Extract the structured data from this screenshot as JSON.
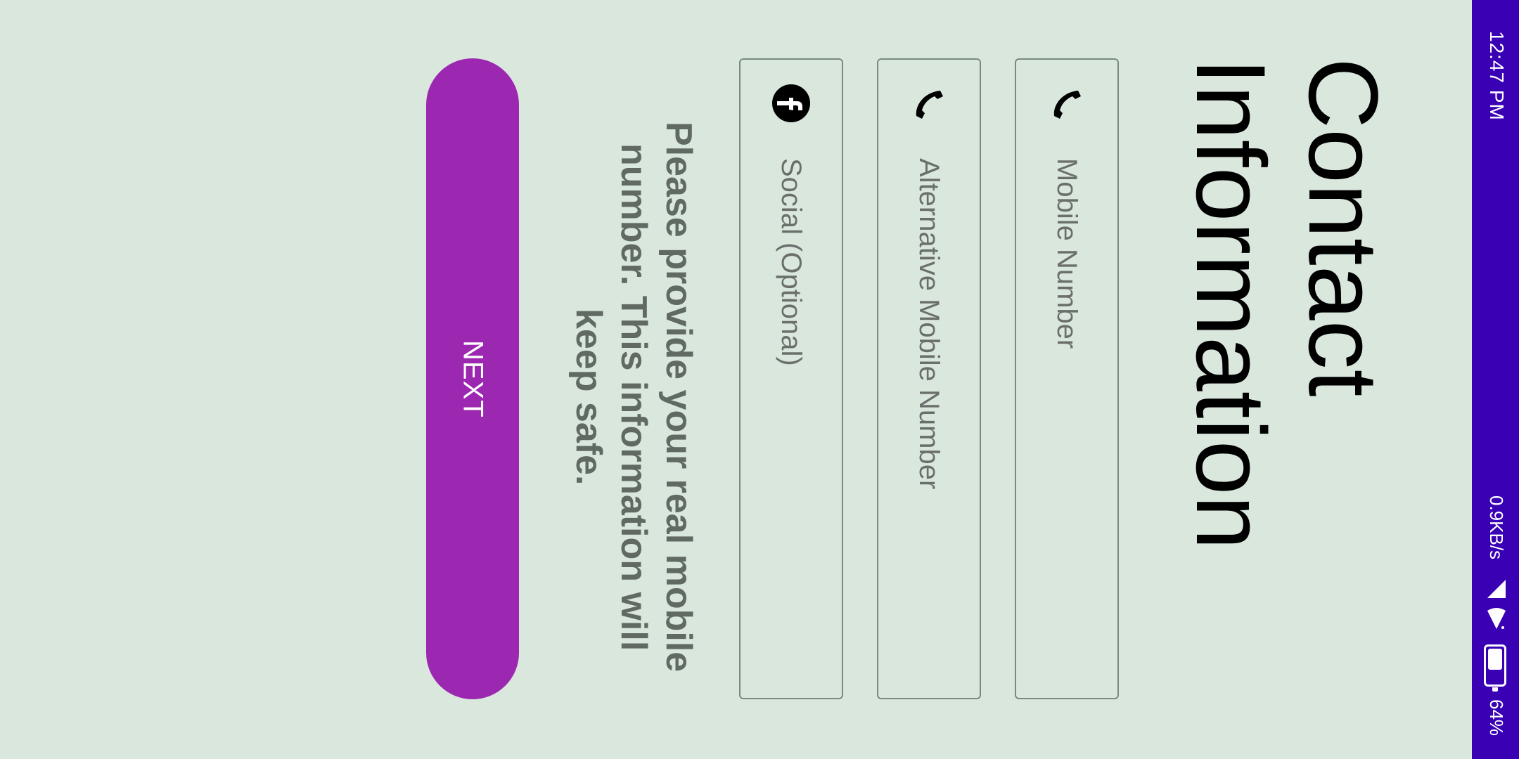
{
  "status_bar": {
    "time": "12:47 PM",
    "network_speed": "0.9KB/s",
    "battery": "64%",
    "icons": [
      "signal-icon",
      "wifi-icon",
      "battery-icon"
    ]
  },
  "title": {
    "line1": "Contact",
    "line2": "Information"
  },
  "fields": {
    "mobile": {
      "label": "Mobile Number",
      "icon": "phone-icon"
    },
    "alternative": {
      "label": "Alternative Mobile Number",
      "icon": "phone-icon"
    },
    "social": {
      "label": "Social (Optional)",
      "icon": "facebook-icon"
    }
  },
  "notice": "Please provide your real mobile number. This information will keep safe.",
  "next_button": {
    "label": "NEXT"
  },
  "colors": {
    "background": "#d9e7dd",
    "status_bar": "#3a00b4",
    "accent": "#9c27b0",
    "field_border": "#7b8a7f"
  }
}
